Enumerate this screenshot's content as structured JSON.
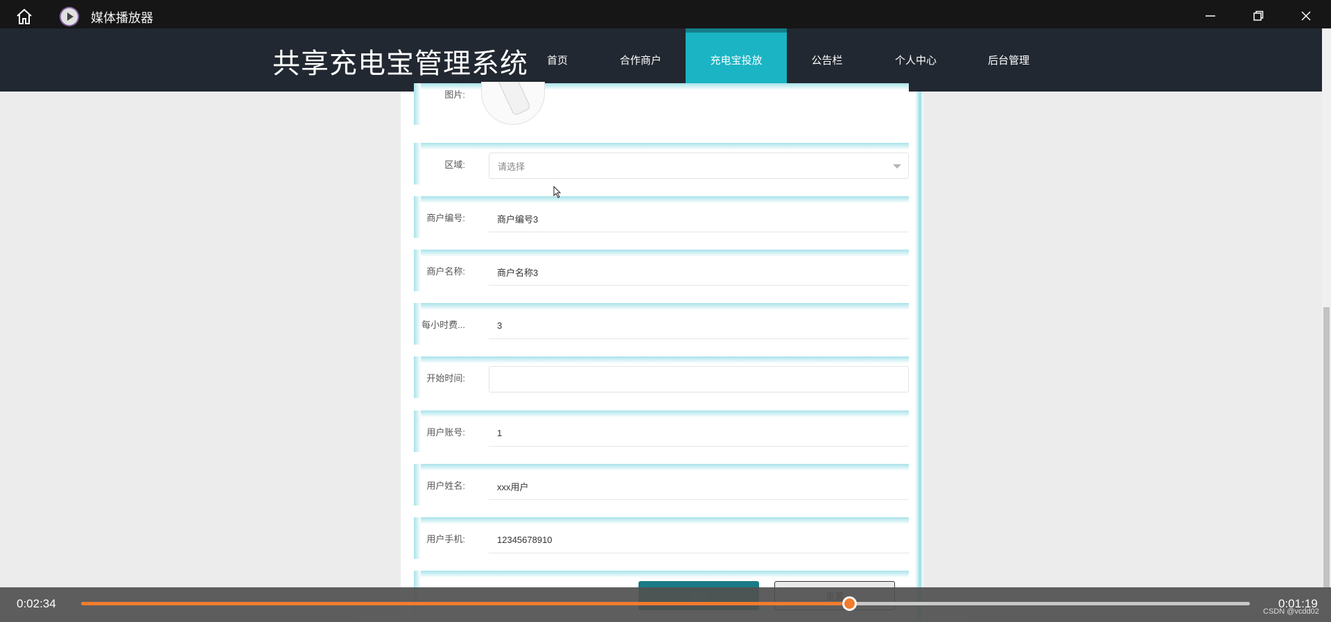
{
  "window": {
    "title": "媒体播放器",
    "icons": {
      "home": "home-icon",
      "app": "play-icon",
      "minimize": "minimize-icon",
      "restore": "restore-icon",
      "close": "close-icon"
    }
  },
  "site": {
    "title": "共享充电宝管理系统",
    "nav": [
      {
        "label": "首页",
        "active": false
      },
      {
        "label": "合作商户",
        "active": false
      },
      {
        "label": "充电宝投放",
        "active": true
      },
      {
        "label": "公告栏",
        "active": false
      },
      {
        "label": "个人中心",
        "active": false
      },
      {
        "label": "后台管理",
        "active": false
      }
    ],
    "accent_color": "#1ab4c4"
  },
  "form": {
    "image_label": "图片:",
    "fields": [
      {
        "label": "区域:",
        "value": "请选择",
        "kind": "select"
      },
      {
        "label": "商户编号:",
        "value": "商户编号3",
        "kind": "text"
      },
      {
        "label": "商户名称:",
        "value": "商户名称3",
        "kind": "text"
      },
      {
        "label": "每小时费...",
        "value": "3",
        "kind": "text"
      },
      {
        "label": "开始时间:",
        "value": "",
        "kind": "input"
      },
      {
        "label": "用户账号:",
        "value": "1",
        "kind": "text"
      },
      {
        "label": "用户姓名:",
        "value": "xxx用户",
        "kind": "text"
      },
      {
        "label": "用户手机:",
        "value": "12345678910",
        "kind": "text"
      }
    ],
    "submit_label": "提交",
    "reset_label": "重置"
  },
  "player": {
    "elapsed": "0:02:34",
    "remaining": "0:01:19",
    "progress_fraction": 0.657,
    "progress_color": "#f07c2e",
    "watermark": "CSDN @vcdd02"
  }
}
